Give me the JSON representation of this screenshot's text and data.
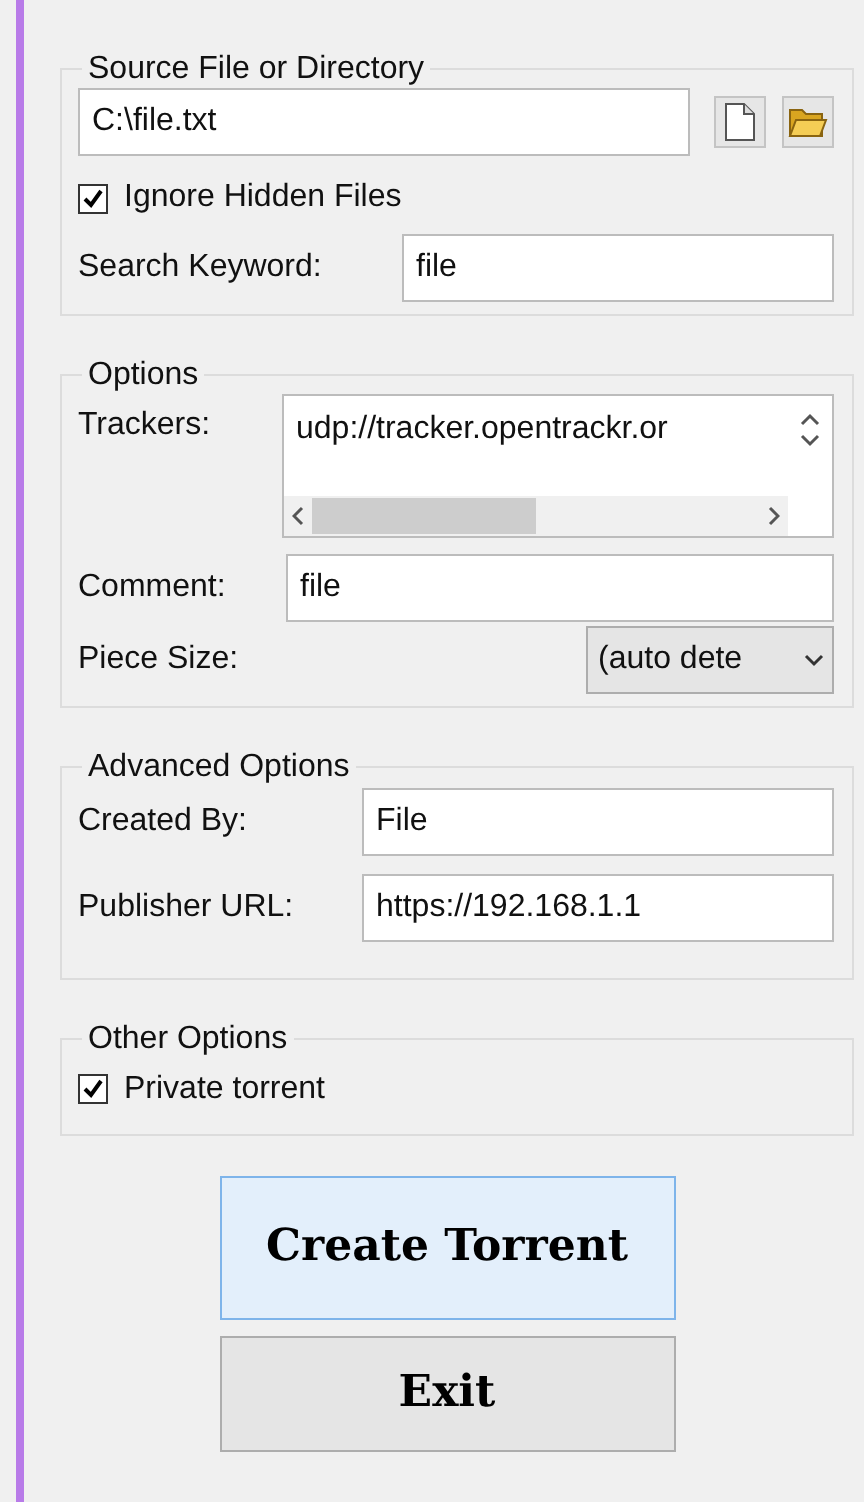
{
  "source": {
    "legend": "Source File or Directory",
    "path_value": "C:\\file.txt",
    "ignore_hidden": {
      "label": "Ignore Hidden Files",
      "checked": true
    },
    "search_label": "Search Keyword:",
    "search_value": "file"
  },
  "options": {
    "legend": "Options",
    "trackers_label": "Trackers:",
    "trackers_value": "udp://tracker.opentrackr.or",
    "comment_label": "Comment:",
    "comment_value": "file",
    "piece_size_label": "Piece Size:",
    "piece_size_value": "(auto dete"
  },
  "advanced": {
    "legend": "Advanced Options",
    "created_by_label": "Created By:",
    "created_by_value": "File",
    "publisher_label": "Publisher URL:",
    "publisher_value": "https://192.168.1.1"
  },
  "other": {
    "legend": "Other Options",
    "private": {
      "label": "Private torrent",
      "checked": true
    }
  },
  "buttons": [
    {
      "label": "Create Torrent",
      "default": true
    },
    {
      "label": "Exit",
      "default": false
    }
  ]
}
